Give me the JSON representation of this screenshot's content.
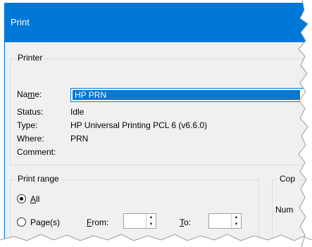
{
  "window": {
    "title": "Print",
    "accent": "#0078d7"
  },
  "printer": {
    "group_label": "Printer",
    "name_label": "Name:",
    "name_value": "HP PRN",
    "status_label": "Status:",
    "status_value": "Idle",
    "type_label": "Type:",
    "type_value": "HP Universal Printing PCL 6 (v6.6.0)",
    "where_label": "Where:",
    "where_value": "PRN",
    "comment_label": "Comment:"
  },
  "print_range": {
    "group_label": "Print range",
    "all_label": "All",
    "pages_label": "Page(s)",
    "from_label": "From:",
    "to_label": "To:",
    "selected": "All"
  },
  "copies": {
    "group_label": "Cop",
    "number_label": "Num"
  }
}
